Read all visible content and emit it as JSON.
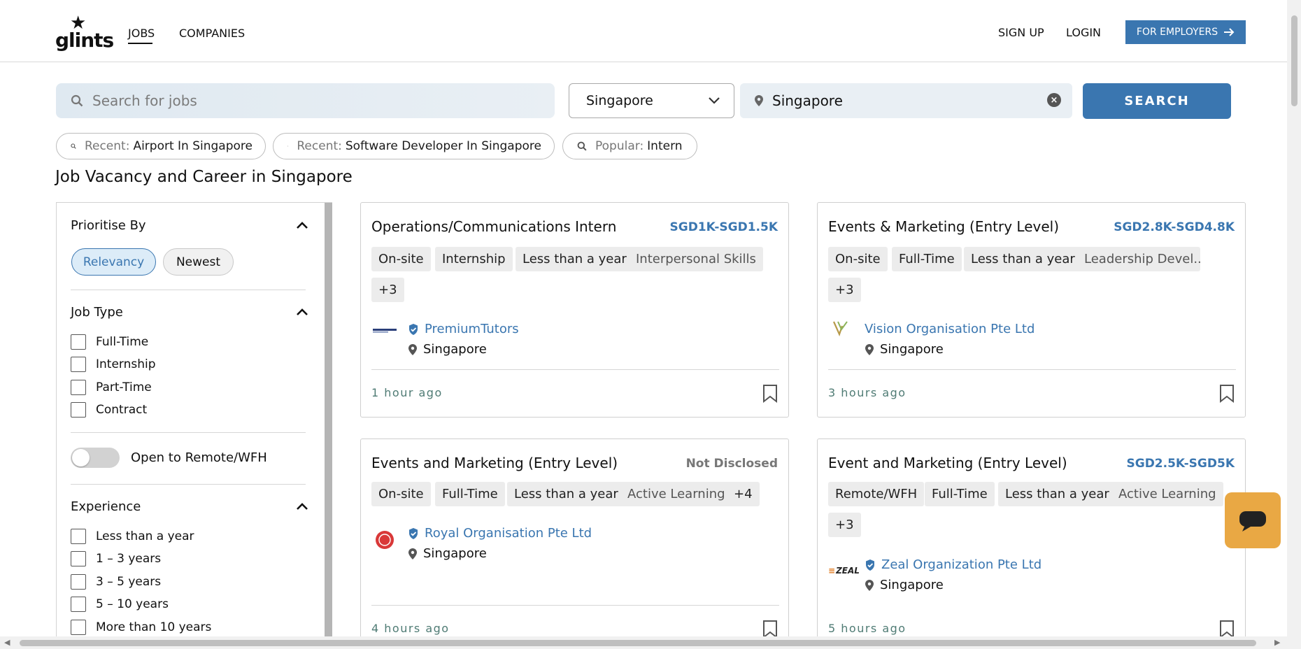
{
  "brand": {
    "logo_text": "glints",
    "accent": "#3a76b0"
  },
  "nav": {
    "jobs": "JOBS",
    "companies": "COMPANIES",
    "sign_up": "SIGN UP",
    "login": "LOGIN",
    "employers": "FOR EMPLOYERS"
  },
  "search": {
    "placeholder": "Search for jobs",
    "country": "Singapore",
    "location": "Singapore",
    "button": "SEARCH"
  },
  "chips": [
    {
      "label": "Recent:",
      "value": "Airport In Singapore"
    },
    {
      "label": "Recent:",
      "value": "Software Developer In Singapore"
    },
    {
      "label": "Popular:",
      "value": "Intern"
    }
  ],
  "page_title": "Job Vacancy and Career in Singapore",
  "filters": {
    "prioritise": {
      "heading": "Prioritise By",
      "options": [
        "Relevancy",
        "Newest"
      ],
      "selected": "Relevancy"
    },
    "job_type": {
      "heading": "Job Type",
      "options": [
        "Full-Time",
        "Internship",
        "Part-Time",
        "Contract"
      ]
    },
    "remote": {
      "label": "Open to Remote/WFH",
      "enabled": false
    },
    "experience": {
      "heading": "Experience",
      "options": [
        "Less than a year",
        "1 – 3 years",
        "3 – 5 years",
        "5 – 10 years",
        "More than 10 years"
      ]
    }
  },
  "jobs": [
    {
      "title": "Operations/Communications Intern",
      "salary": "SGD1K-SGD1.5K",
      "tags": [
        "On-site",
        "Internship",
        "Less than a year",
        "Interpersonal Skills",
        "+3"
      ],
      "company": "PremiumTutors",
      "location": "Singapore",
      "posted": "1 hour ago"
    },
    {
      "title": "Events & Marketing (Entry Level)",
      "salary": "SGD2.8K-SGD4.8K",
      "tags": [
        "On-site",
        "Full-Time",
        "Less than a year",
        "Leadership Devel...",
        "+3"
      ],
      "company": "Vision Organisation Pte Ltd",
      "location": "Singapore",
      "posted": "3 hours ago"
    },
    {
      "title": "Events and Marketing (Entry Level)",
      "salary": "Not Disclosed",
      "tags": [
        "On-site",
        "Full-Time",
        "Less than a year",
        "Active Learning",
        "+4"
      ],
      "company": "Royal Organisation Pte Ltd",
      "location": "Singapore",
      "posted": "4 hours ago"
    },
    {
      "title": "Event and Marketing (Entry Level)",
      "salary": "SGD2.5K-SGD5K",
      "tags": [
        "Remote/WFH",
        "Full-Time",
        "Less than a year",
        "Active Learning",
        "+3"
      ],
      "company": "Zeal Organization Pte Ltd",
      "location": "Singapore",
      "posted": "5 hours ago",
      "logo_text": "ZEAL"
    }
  ]
}
